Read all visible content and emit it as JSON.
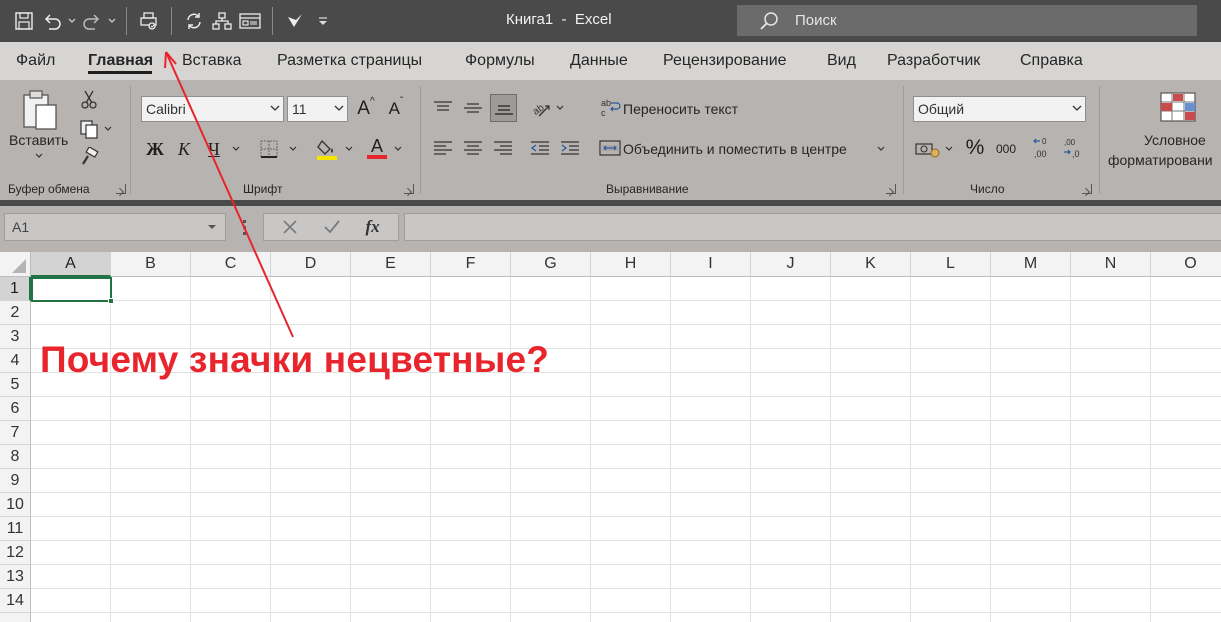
{
  "window": {
    "title": "Книга1  -  Excel",
    "search_placeholder": "Поиск"
  },
  "qat": {
    "icons": [
      "save-icon",
      "undo-icon",
      "redo-icon",
      "print-preview-icon",
      "refresh-icon",
      "hierarchy-icon",
      "form-icon",
      "touch-mode-icon",
      "customize-qat-icon"
    ]
  },
  "tabs": [
    {
      "label": "Файл",
      "active": false
    },
    {
      "label": "Главная",
      "active": true
    },
    {
      "label": "Вставка",
      "active": false
    },
    {
      "label": "Разметка страницы",
      "active": false
    },
    {
      "label": "Формулы",
      "active": false
    },
    {
      "label": "Данные",
      "active": false
    },
    {
      "label": "Рецензирование",
      "active": false
    },
    {
      "label": "Вид",
      "active": false
    },
    {
      "label": "Разработчик",
      "active": false
    },
    {
      "label": "Справка",
      "active": false
    }
  ],
  "ribbon": {
    "clipboard": {
      "paste_label": "Вставить",
      "group_label": "Буфер обмена"
    },
    "font": {
      "font_name": "Calibri",
      "font_size": "11",
      "bold": "Ж",
      "italic": "К",
      "underline": "Ч",
      "increase_font": "A",
      "decrease_font": "A",
      "font_color_letter": "A",
      "group_label": "Шрифт"
    },
    "alignment": {
      "wrap_text": "Переносить текст",
      "merge_center": "Объединить и поместить в центре",
      "group_label": "Выравнивание"
    },
    "number": {
      "format": "Общий",
      "percent": "%",
      "thousands": "000",
      "group_label": "Число"
    },
    "styles": {
      "conditional_line1": "Условное",
      "conditional_line2": "форматировани"
    }
  },
  "formula_bar": {
    "name_box": "A1",
    "fx": "fx",
    "value": ""
  },
  "sheet": {
    "columns": [
      "A",
      "B",
      "C",
      "D",
      "E",
      "F",
      "G",
      "H",
      "I",
      "J",
      "K",
      "L",
      "M",
      "N",
      "O"
    ],
    "rows": [
      "1",
      "2",
      "3",
      "4",
      "5",
      "6",
      "7",
      "8",
      "9",
      "10",
      "11",
      "12",
      "13",
      "14"
    ],
    "selected_cell": "A1"
  },
  "annotation": {
    "question": "Почему значки нецветные?",
    "color": "#e8242c"
  },
  "colors": {
    "titlebar": "#4a4a4a",
    "ribbon": "#b7b3b1",
    "tabs": "#d6d5d3",
    "excel_green": "#217346",
    "highlight_yellow": "#f5e400",
    "font_red": "#e8242c"
  }
}
